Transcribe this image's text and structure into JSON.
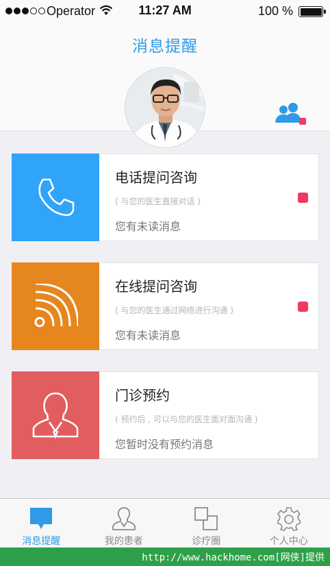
{
  "status_bar": {
    "carrier": "Operator",
    "time": "11:27 AM",
    "battery": "100 %"
  },
  "header": {
    "title": "消息提醒"
  },
  "cards": [
    {
      "title": "电话提问咨询",
      "subtitle": "( 与您的医生直接对话 )",
      "status": "您有未读消息",
      "unread": true,
      "color": "#30a4f8",
      "icon": "phone-icon"
    },
    {
      "title": "在线提问咨询",
      "subtitle": "( 与您的医生通过网络进行沟通 )",
      "status": "您有未读消息",
      "unread": true,
      "color": "#e6861e",
      "icon": "rss-icon"
    },
    {
      "title": "门诊预约",
      "subtitle": "( 预约后 , 可以与您的医生面对面沟通 )",
      "status": "您暂时没有预约消息",
      "unread": false,
      "color": "#e25d5e",
      "icon": "doctor-icon"
    }
  ],
  "tabbar": {
    "active": 0,
    "tabs": [
      {
        "label": "消息提醒",
        "icon": "chat-bubble-icon"
      },
      {
        "label": "我的患者",
        "icon": "patient-icon"
      },
      {
        "label": "诊疗圈",
        "icon": "squares-icon"
      },
      {
        "label": "个人中心",
        "icon": "gear-icon"
      }
    ]
  },
  "footer": {
    "watermark": "http://www.hackhome.com[网侠]提供"
  },
  "colors": {
    "accent": "#2f9be6",
    "badge": "#f03a5f",
    "footer": "#2ea04a"
  }
}
